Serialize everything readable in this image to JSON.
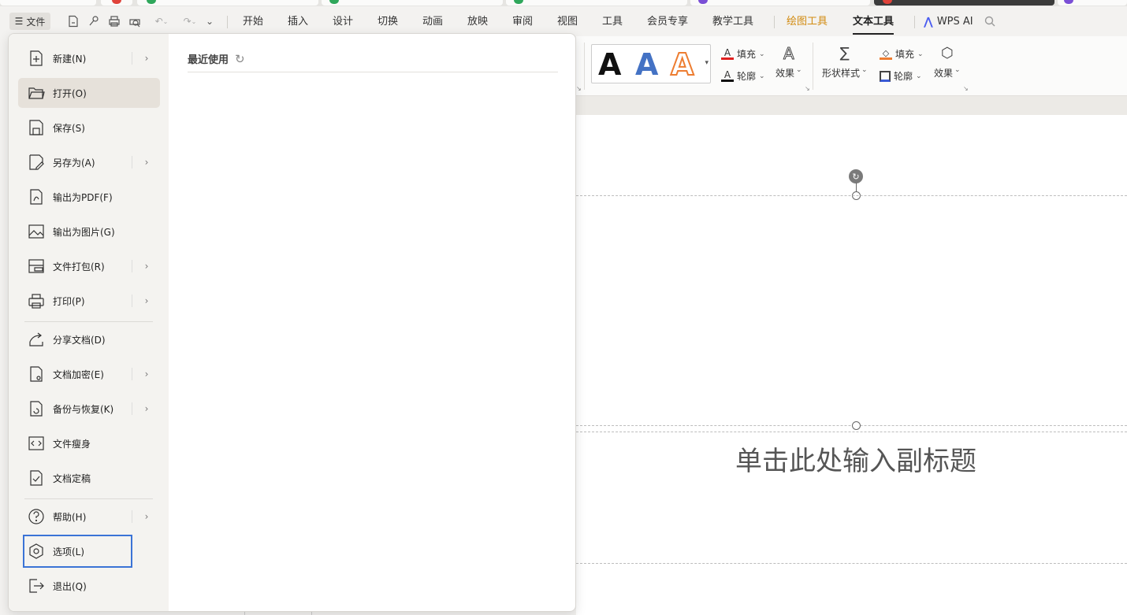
{
  "menubar": {
    "file_label": "文件",
    "tabs": [
      {
        "label": "开始"
      },
      {
        "label": "插入"
      },
      {
        "label": "设计"
      },
      {
        "label": "切换"
      },
      {
        "label": "动画"
      },
      {
        "label": "放映"
      },
      {
        "label": "审阅"
      },
      {
        "label": "视图"
      },
      {
        "label": "工具"
      },
      {
        "label": "会员专享"
      },
      {
        "label": "教学工具"
      },
      {
        "label": "绘图工具"
      },
      {
        "label": "文本工具"
      },
      {
        "label": "WPS AI"
      }
    ]
  },
  "ribbon": {
    "text_fill": "填充",
    "text_outline": "轮廓",
    "text_effect": "效果",
    "shape_style": "形状样式",
    "shape_fill": "填充",
    "shape_outline": "轮廓",
    "shape_effect": "效果",
    "art_letter": "A"
  },
  "file_menu": {
    "items": [
      {
        "label": "新建(N)",
        "icon": "new-file-icon"
      },
      {
        "label": "打开(O)",
        "icon": "folder-open-icon"
      },
      {
        "label": "保存(S)",
        "icon": "save-icon"
      },
      {
        "label": "另存为(A)",
        "icon": "save-as-icon"
      },
      {
        "label": "输出为PDF(F)",
        "icon": "pdf-export-icon"
      },
      {
        "label": "输出为图片(G)",
        "icon": "image-export-icon"
      },
      {
        "label": "文件打包(R)",
        "icon": "package-icon"
      },
      {
        "label": "打印(P)",
        "icon": "print-icon"
      },
      {
        "label": "分享文档(D)",
        "icon": "share-icon"
      },
      {
        "label": "文档加密(E)",
        "icon": "encrypt-icon"
      },
      {
        "label": "备份与恢复(K)",
        "icon": "backup-icon"
      },
      {
        "label": "文件瘦身",
        "icon": "slim-icon"
      },
      {
        "label": "文档定稿",
        "icon": "finalize-icon"
      },
      {
        "label": "帮助(H)",
        "icon": "help-icon"
      },
      {
        "label": "选项(L)",
        "icon": "options-icon"
      },
      {
        "label": "退出(Q)",
        "icon": "exit-icon"
      }
    ],
    "recent_title": "最近使用"
  },
  "slide": {
    "subtitle_placeholder": "单击此处输入副标题"
  },
  "colors": {
    "accent_orange": "#d28b10",
    "focus_blue": "#3b73d6",
    "art_blue": "#4472c4",
    "art_orange": "#ed7d31",
    "fill_red": "#e02020"
  }
}
